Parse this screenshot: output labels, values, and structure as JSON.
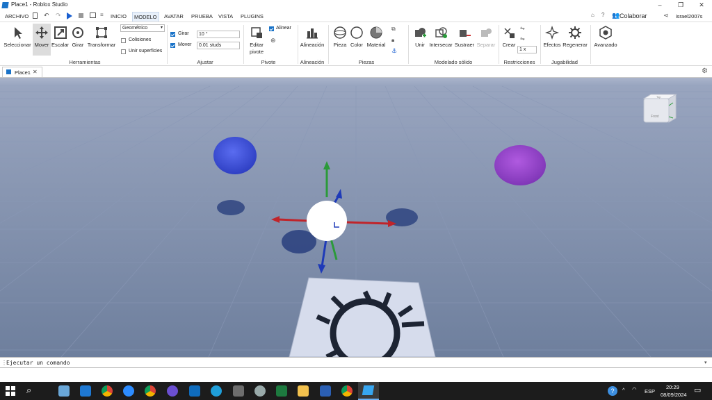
{
  "window": {
    "title": "Place1 - Roblox Studio"
  },
  "menu": {
    "file": "ARCHIVO",
    "tabs": [
      "INICIO",
      "MODELO",
      "AVATAR",
      "PRUEBA",
      "VISTA",
      "PLUGINS"
    ],
    "active_tab": "MODELO",
    "collaborate": "Colaborar",
    "user": "israel2007s"
  },
  "ribbon": {
    "tools": {
      "select": "Seleccionar",
      "move": "Mover",
      "scale": "Escalar",
      "rotate": "Girar",
      "transform": "Transformar"
    },
    "tools_group": "Herramientas",
    "mode_select": "Geométrico",
    "collisions": "Colisiones",
    "join_surfaces": "Unir superficies",
    "snap": {
      "rotate_label": "Girar",
      "rotate_value": "10 °",
      "move_label": "Mover",
      "move_value": "0.01 studs"
    },
    "snap_group": "Ajustar",
    "pivot": {
      "edit": "Editar pivote",
      "align": "Alinear"
    },
    "pivot_group": "Pivote",
    "alignment": "Alineación",
    "alignment_group": "Alineación",
    "parts": {
      "part": "Pieza",
      "color": "Color",
      "material": "Material"
    },
    "parts_group": "Piezas",
    "solid": {
      "union": "Unir",
      "intersect": "Intersecar",
      "negate": "Sustraer",
      "separate": "Separar"
    },
    "solid_group": "Modelado sólido",
    "constraints": {
      "create": "Crear",
      "scale_value": "1 x"
    },
    "constraints_group": "Restricciones",
    "gameplay": {
      "effects": "Efectos",
      "regen": "Regenerar"
    },
    "gameplay_group": "Jugabilidad",
    "advanced": "Avanzado"
  },
  "doc_tab": {
    "label": "Place1"
  },
  "viewcube": {
    "top": "Top",
    "front": "Front"
  },
  "command_bar": {
    "placeholder": "Ejecutar un comando"
  },
  "taskbar": {
    "lang": "ESP",
    "time": "20:29",
    "date": "08/09/2024"
  },
  "colors": {
    "accent": "#1a73c8",
    "sky": "#a9b6cf",
    "ground": "#7b8aa6",
    "blue_ball": "#3a4fd8",
    "purple_ball": "#9a46c9"
  }
}
